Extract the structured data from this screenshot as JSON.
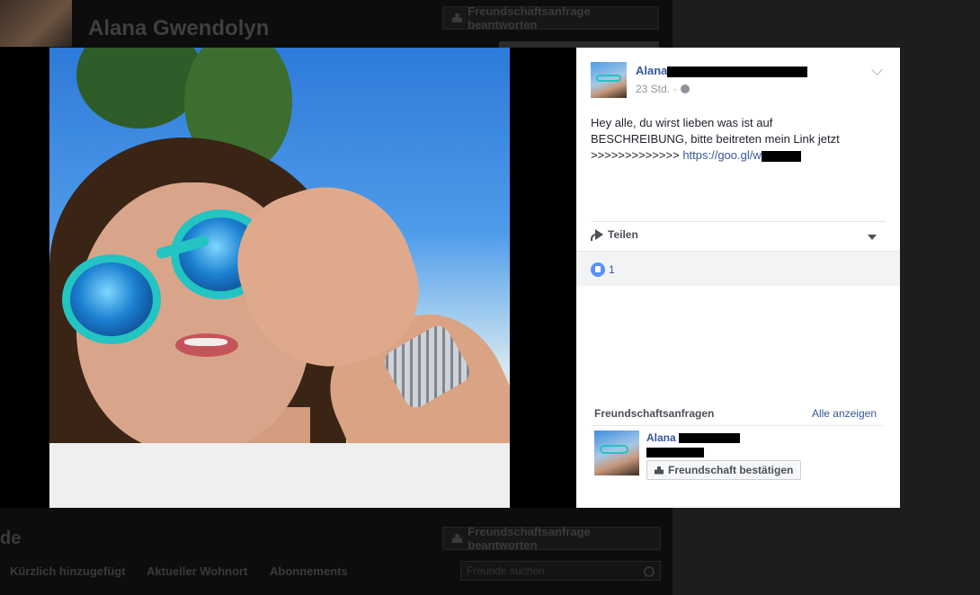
{
  "background_page": {
    "profile_name": "Alana Gwendolyn",
    "respond_button": "Freundschaftsanfrage beantworten",
    "section_title": "de",
    "tabs": [
      "Kürzlich hinzugefügt",
      "Aktueller Wohnort",
      "Abonnements"
    ],
    "respond_button_2": "Freundschaftsanfrage beantworten",
    "search_placeholder": "Freunde suchen"
  },
  "post": {
    "author_first_name": "Alana",
    "author_last_name_redacted": true,
    "time": "23 Std.",
    "separator": "·",
    "text_line1": "Hey alle, du wirst lieben was ist auf",
    "text_line2": "BESCHREIBUNG, bitte beitreten mein Link jetzt",
    "text_line3_prefix": ">>>>>>>>>>>>> ",
    "link_text": "https://goo.gl/w",
    "share_label": "Teilen",
    "like_count": "1"
  },
  "friend_requests": {
    "title": "Freundschaftsanfragen",
    "see_all": "Alle anzeigen",
    "request_first_name": "Alana",
    "confirm_button": "Freundschaft bestätigen"
  },
  "colors": {
    "link_blue": "#365899",
    "like_blue": "#5890ff",
    "glasses_teal": "#23c4c1"
  },
  "icons": [
    "globe-icon",
    "chevron-down-icon",
    "share-icon",
    "like-icon",
    "add-friend-icon",
    "search-icon"
  ]
}
